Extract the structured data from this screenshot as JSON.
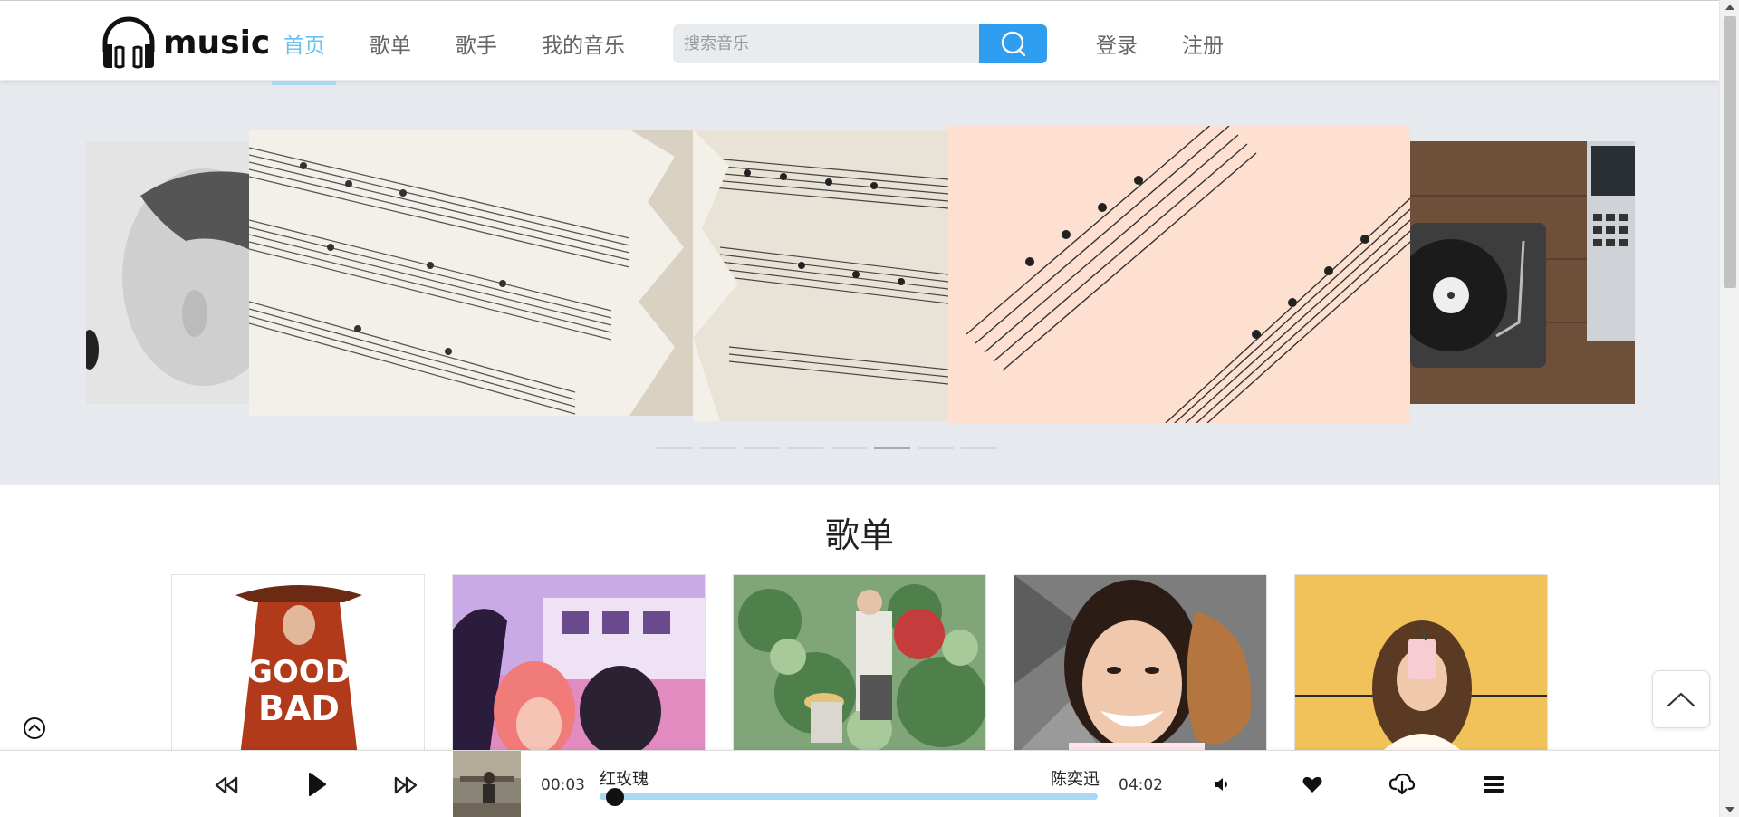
{
  "brand": {
    "name": "music"
  },
  "nav": {
    "items": [
      {
        "label": "首页",
        "active": true
      },
      {
        "label": "歌单",
        "active": false
      },
      {
        "label": "歌手",
        "active": false
      },
      {
        "label": "我的音乐",
        "active": false
      }
    ]
  },
  "search": {
    "placeholder": "搜索音乐",
    "value": ""
  },
  "auth": {
    "login": "登录",
    "register": "注册"
  },
  "carousel": {
    "slides": 8,
    "active_index": 5
  },
  "playlist_section": {
    "title": "歌单"
  },
  "player": {
    "current_time": "00:03",
    "total_time": "04:02",
    "song_title": "红玫瑰",
    "artist": "陈奕迅",
    "progress": 0.0125
  },
  "colors": {
    "accent": "#6cc0ee",
    "search_button": "#2f9ef0",
    "progress": "#a9d8f4"
  },
  "icons": [
    "headphones-icon",
    "search-icon",
    "rewind-icon",
    "play-icon",
    "fast-forward-icon",
    "volume-icon",
    "heart-icon",
    "cloud-download-icon",
    "menu-icon",
    "chevron-up-icon",
    "circle-chevron-up-icon"
  ]
}
